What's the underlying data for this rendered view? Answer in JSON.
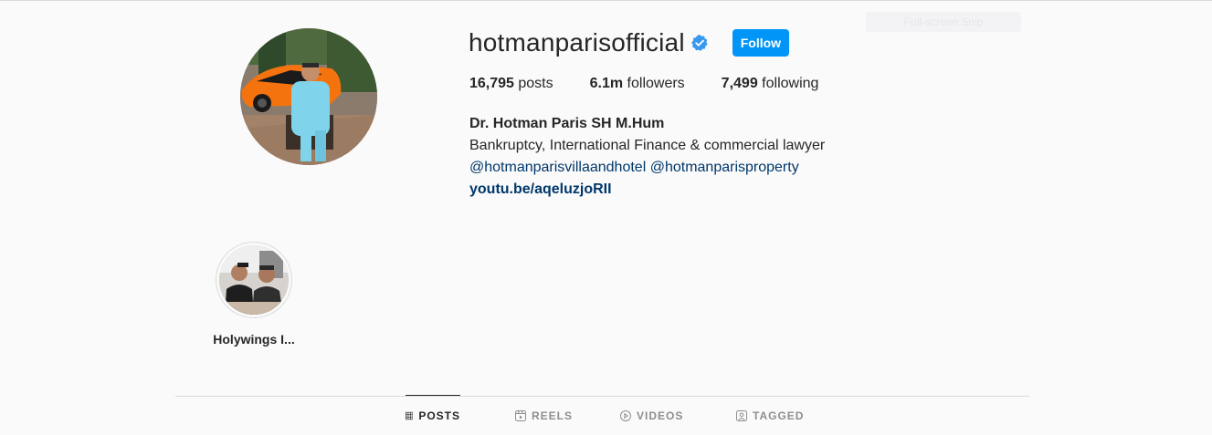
{
  "overlay": {
    "snip_label": "Full-screen Snip"
  },
  "profile": {
    "username": "hotmanparisofficial",
    "verified": true,
    "follow_label": "Follow",
    "stats": {
      "posts_count": "16,795",
      "posts_label": " posts",
      "followers_count": "6.1m",
      "followers_label": " followers",
      "following_count": "7,499",
      "following_label": " following"
    },
    "bio": {
      "full_name": "Dr. Hotman Paris SH M.Hum",
      "description": "Bankruptcy, International Finance & commercial lawyer",
      "mention_1": "@hotmanparisvillaandhotel",
      "mention_2": "@hotmanparisproperty",
      "link": "youtu.be/aqeluzjoRII"
    }
  },
  "highlights": [
    {
      "label": "Holywings I..."
    }
  ],
  "tabs": [
    {
      "label": "POSTS",
      "icon": "grid-icon",
      "active": true
    },
    {
      "label": "REELS",
      "icon": "reels-icon",
      "active": false
    },
    {
      "label": "VIDEOS",
      "icon": "video-icon",
      "active": false
    },
    {
      "label": "TAGGED",
      "icon": "tagged-icon",
      "active": false
    }
  ],
  "colors": {
    "accent": "#0095f6",
    "link": "#00376b",
    "text": "#262626",
    "muted": "#8e8e8e",
    "background": "#fafafa",
    "border": "#dbdbdb"
  }
}
